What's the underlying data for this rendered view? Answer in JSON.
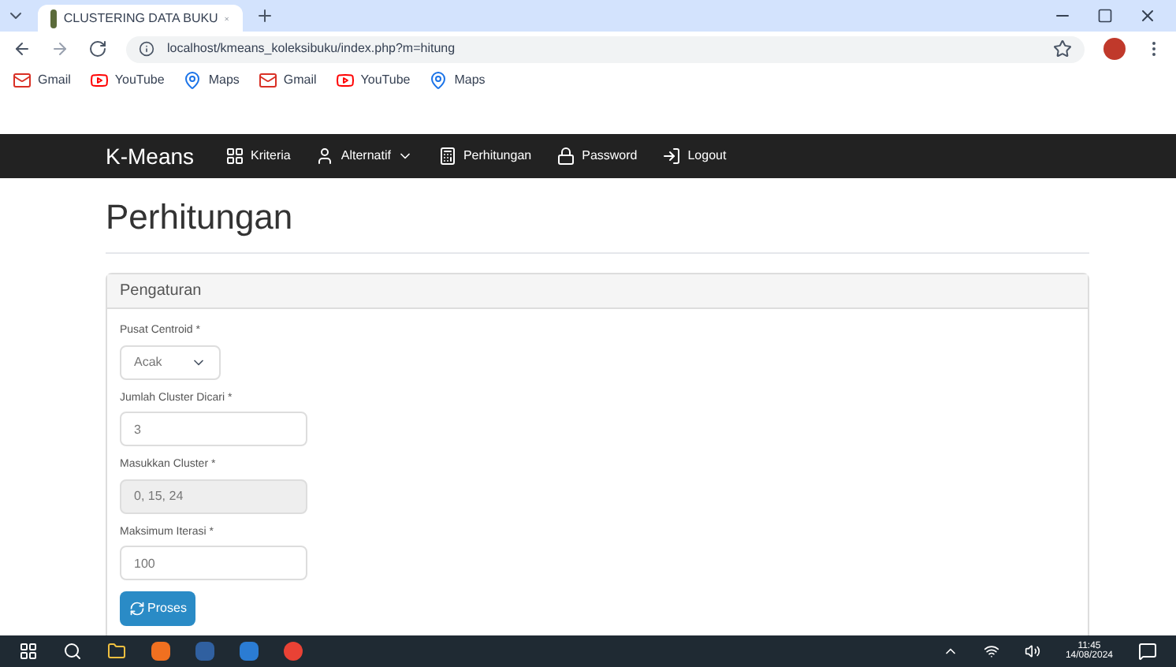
{
  "browser": {
    "tab_title": "CLUSTERING DATA BUKU",
    "url": "localhost/kmeans_koleksibuku/index.php?m=hitung",
    "bookmarks": [
      {
        "label": "Gmail",
        "kind": "gmail"
      },
      {
        "label": "YouTube",
        "kind": "youtube"
      },
      {
        "label": "Maps",
        "kind": "maps"
      },
      {
        "label": "Gmail",
        "kind": "gmail"
      },
      {
        "label": "YouTube",
        "kind": "youtube"
      },
      {
        "label": "Maps",
        "kind": "maps"
      }
    ]
  },
  "navbar": {
    "brand": "K-Means",
    "items": [
      {
        "label": "Kriteria",
        "kind": "grid",
        "dropdown": false
      },
      {
        "label": "Alternatif",
        "kind": "user",
        "dropdown": true
      },
      {
        "label": "Perhitungan",
        "kind": "calc",
        "dropdown": false
      },
      {
        "label": "Password",
        "kind": "lock",
        "dropdown": false
      },
      {
        "label": "Logout",
        "kind": "logout",
        "dropdown": false
      }
    ]
  },
  "page": {
    "title": "Perhitungan",
    "panel_title": "Pengaturan",
    "fields": [
      {
        "label": "Pusat Centroid *",
        "kind": "select",
        "value": "Acak",
        "disabled": false
      },
      {
        "label": "Jumlah Cluster Dicari *",
        "kind": "input",
        "value": "3",
        "disabled": false
      },
      {
        "label": "Masukkan Cluster *",
        "kind": "input",
        "value": "0, 15, 24",
        "disabled": true
      },
      {
        "label": "Maksimum Iterasi *",
        "kind": "input",
        "value": "100",
        "disabled": false
      }
    ],
    "button": "Proses"
  },
  "taskbar": {
    "time": "11:45",
    "date": "14/08/2024"
  }
}
